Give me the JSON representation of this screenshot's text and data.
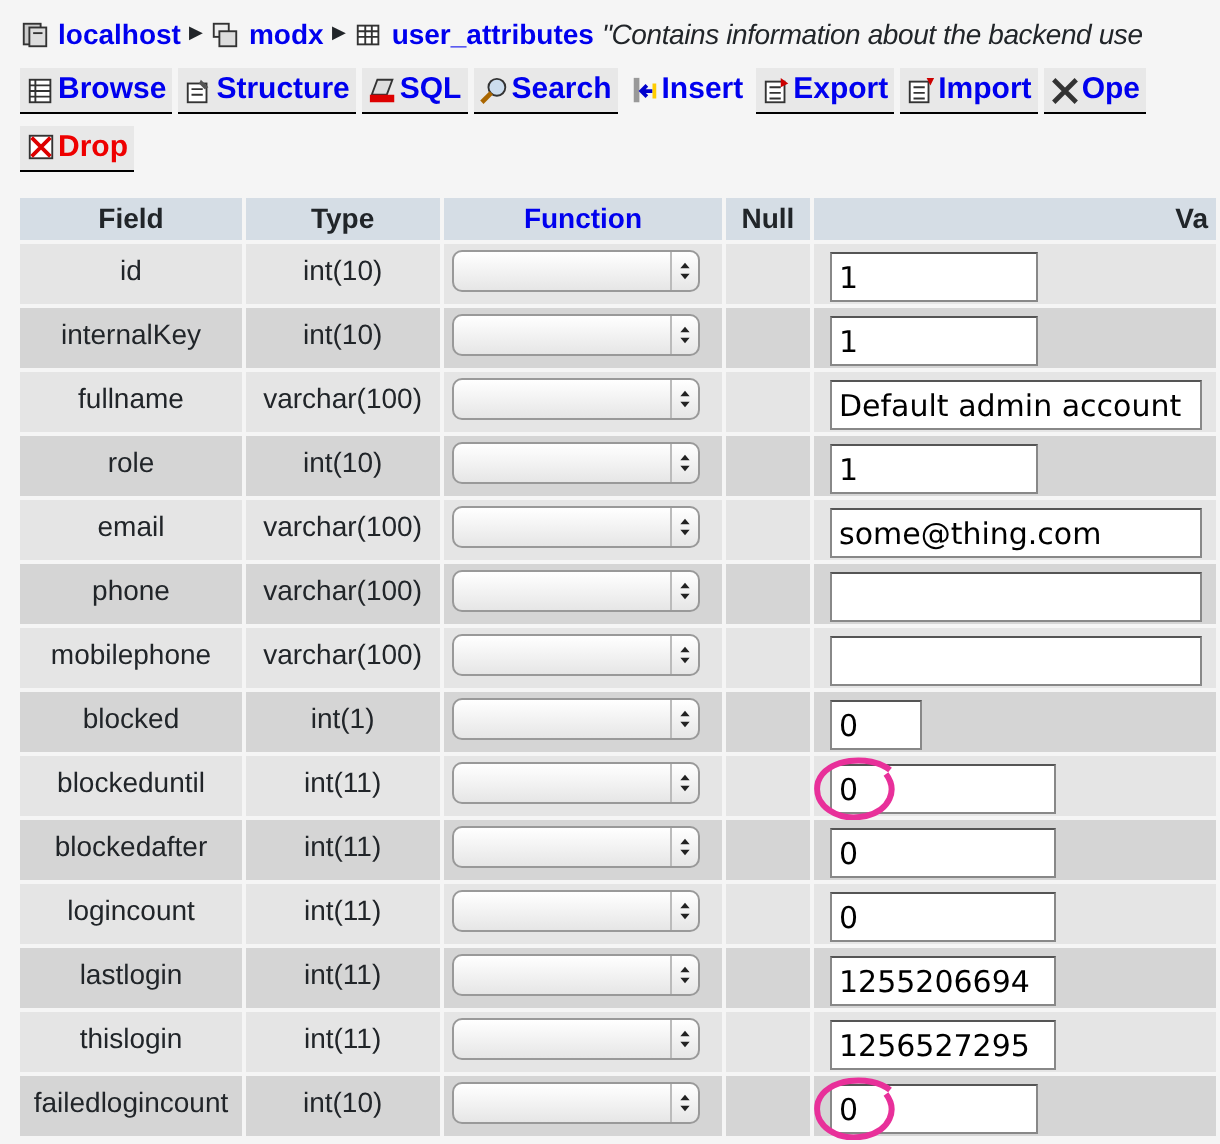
{
  "breadcrumb": [
    {
      "label": "localhost",
      "kind": "server"
    },
    {
      "label": "modx",
      "kind": "database",
      "separator": "▶"
    },
    {
      "label": "user_attributes",
      "kind": "table",
      "separator": "▶"
    }
  ],
  "comment": "\"Contains information about the backend use",
  "tabs": [
    {
      "label": "Browse",
      "kind": "browse",
      "selected": false
    },
    {
      "label": "Structure",
      "kind": "structure",
      "selected": false
    },
    {
      "label": "SQL",
      "kind": "sql",
      "selected": false
    },
    {
      "label": "Search",
      "kind": "search",
      "selected": false
    },
    {
      "label": "Insert",
      "kind": "insert",
      "selected": true
    },
    {
      "label": "Export",
      "kind": "export",
      "selected": false
    },
    {
      "label": "Import",
      "kind": "import",
      "selected": false
    },
    {
      "label": "Ope",
      "kind": "operations",
      "selected": false
    },
    {
      "label": "Drop",
      "kind": "drop",
      "selected": false
    }
  ],
  "table": {
    "columns": [
      "Field",
      "Type",
      "Function",
      "Null",
      "Va"
    ],
    "rows": [
      {
        "field": "id",
        "type": "int(10)",
        "value": "1",
        "kind": "medium",
        "circled": false
      },
      {
        "field": "internalKey",
        "type": "int(10)",
        "value": "1",
        "kind": "medium",
        "circled": false
      },
      {
        "field": "fullname",
        "type": "varchar(100)",
        "value": "Default admin account",
        "kind": "wide",
        "circled": false
      },
      {
        "field": "role",
        "type": "int(10)",
        "value": "1",
        "kind": "medium",
        "circled": false
      },
      {
        "field": "email",
        "type": "varchar(100)",
        "value": "some@thing.com",
        "kind": "wide",
        "circled": false
      },
      {
        "field": "phone",
        "type": "varchar(100)",
        "kind": "wide",
        "circled": false
      },
      {
        "field": "mobilephone",
        "type": "varchar(100)",
        "kind": "wide",
        "circled": false
      },
      {
        "field": "blocked",
        "type": "int(1)",
        "value": "0",
        "kind": "narrow",
        "circled": false
      },
      {
        "field": "blockeduntil",
        "type": "int(11)",
        "value": "0",
        "kind": "long",
        "circled": true
      },
      {
        "field": "blockedafter",
        "type": "int(11)",
        "value": "0",
        "kind": "long",
        "circled": false
      },
      {
        "field": "logincount",
        "type": "int(11)",
        "value": "0",
        "kind": "long",
        "circled": false
      },
      {
        "field": "lastlogin",
        "type": "int(11)",
        "value": "1255206694",
        "kind": "long",
        "circled": false
      },
      {
        "field": "thislogin",
        "type": "int(11)",
        "value": "1256527295",
        "kind": "long",
        "circled": false
      },
      {
        "field": "failedlogincount",
        "type": "int(10)",
        "value": "0",
        "kind": "medium",
        "circled": true
      }
    ]
  }
}
